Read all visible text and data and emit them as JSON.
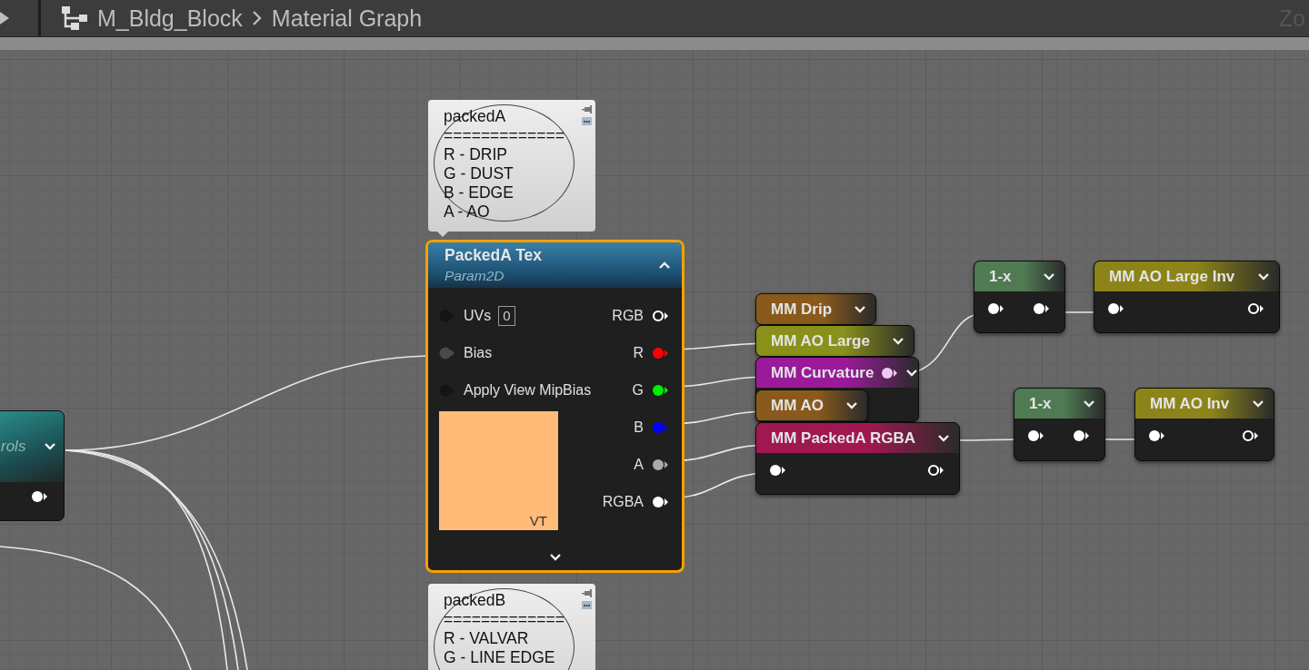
{
  "breadcrumb": {
    "asset": "M_Bldg_Block",
    "graph": "Material Graph",
    "corner_text": "Zo"
  },
  "partial_node": {
    "title": "rols",
    "output_connected": true
  },
  "comments": [
    {
      "title": "packedA",
      "lines": [
        "=============",
        "R - DRIP",
        "G - DUST",
        "B - EDGE",
        "A - AO"
      ]
    },
    {
      "title": "packedB",
      "lines": [
        "=============",
        "R - VALVAR",
        "G - LINE EDGE"
      ]
    }
  ],
  "texture_node": {
    "title": "PackedA Tex",
    "subtitle": "Param2D",
    "selected": true,
    "badge": "VT",
    "inputs": [
      {
        "label": "UVs",
        "value": "0",
        "connected": false
      },
      {
        "label": "Bias",
        "connected": true
      },
      {
        "label": "Apply View MipBias",
        "connected": false
      }
    ],
    "outputs": [
      {
        "label": "RGB",
        "color": "#ffffff",
        "connected": false
      },
      {
        "label": "R",
        "color": "#ff0000",
        "connected": true
      },
      {
        "label": "G",
        "color": "#00ee00",
        "connected": true
      },
      {
        "label": "B",
        "color": "#0000ff",
        "connected": true
      },
      {
        "label": "A",
        "color": "#aaaaaa",
        "connected": true
      },
      {
        "label": "RGBA",
        "color": "#ffffff",
        "connected": true
      }
    ]
  },
  "function_nodes": [
    {
      "title": "MM Drip",
      "color": "#8a5a1c"
    },
    {
      "title": "MM AO Large",
      "color": "#8a911a"
    },
    {
      "title": "MM Curvature",
      "color": "#9a1a9a",
      "output_connected": true
    },
    {
      "title": "MM AO",
      "color": "#8a5a1c"
    },
    {
      "title": "MM PackedA RGBA",
      "color": "#a0184f",
      "input_connected": true,
      "output_connected": false
    },
    {
      "title": "1-x",
      "color": "#4f7a52",
      "input_connected": true,
      "output_connected": true
    },
    {
      "title": "MM AO Large Inv",
      "color": "#8c8418",
      "input_connected": true,
      "output_connected": false
    },
    {
      "title": "1-x",
      "color": "#4f7a52",
      "input_connected": true,
      "output_connected": true
    },
    {
      "title": "MM AO Inv",
      "color": "#8c8418",
      "input_connected": true,
      "output_connected": false
    }
  ]
}
